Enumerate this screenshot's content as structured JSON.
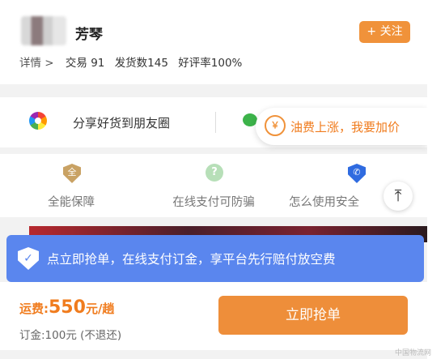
{
  "header": {
    "seller_name": "芳琴",
    "follow_label": "+ 关注",
    "detail_label": "详情 >",
    "stats": [
      "交易 91",
      "发货数145",
      "好评率100%"
    ]
  },
  "share": {
    "label": "分享好货到朋友圈",
    "bubble_icon": "￥",
    "bubble_text": "油费上涨，我要加价"
  },
  "guarantees": [
    {
      "icon": "gold-shield-icon",
      "glyph": "全",
      "label": "全能保障"
    },
    {
      "icon": "green-question-icon",
      "glyph": "?",
      "label": "在线支付可防骗"
    },
    {
      "icon": "blue-phone-shield-icon",
      "glyph": "✆",
      "label": "怎么使用安全"
    }
  ],
  "back_to_top": "⤒",
  "banner": {
    "icon_glyph": "✓",
    "text": "点立即抢单，在线支付订金，享平台先行赔付放空费"
  },
  "bottom": {
    "freight_label": "运费:",
    "freight_amount": "550",
    "freight_unit": "元/趟",
    "deposit": "订金:100元 (不退还)",
    "grab_label": "立即抢单"
  },
  "watermark": "中国物流网",
  "colors": {
    "accent_orange": "#f0923a",
    "banner_blue": "#5a86ee"
  }
}
